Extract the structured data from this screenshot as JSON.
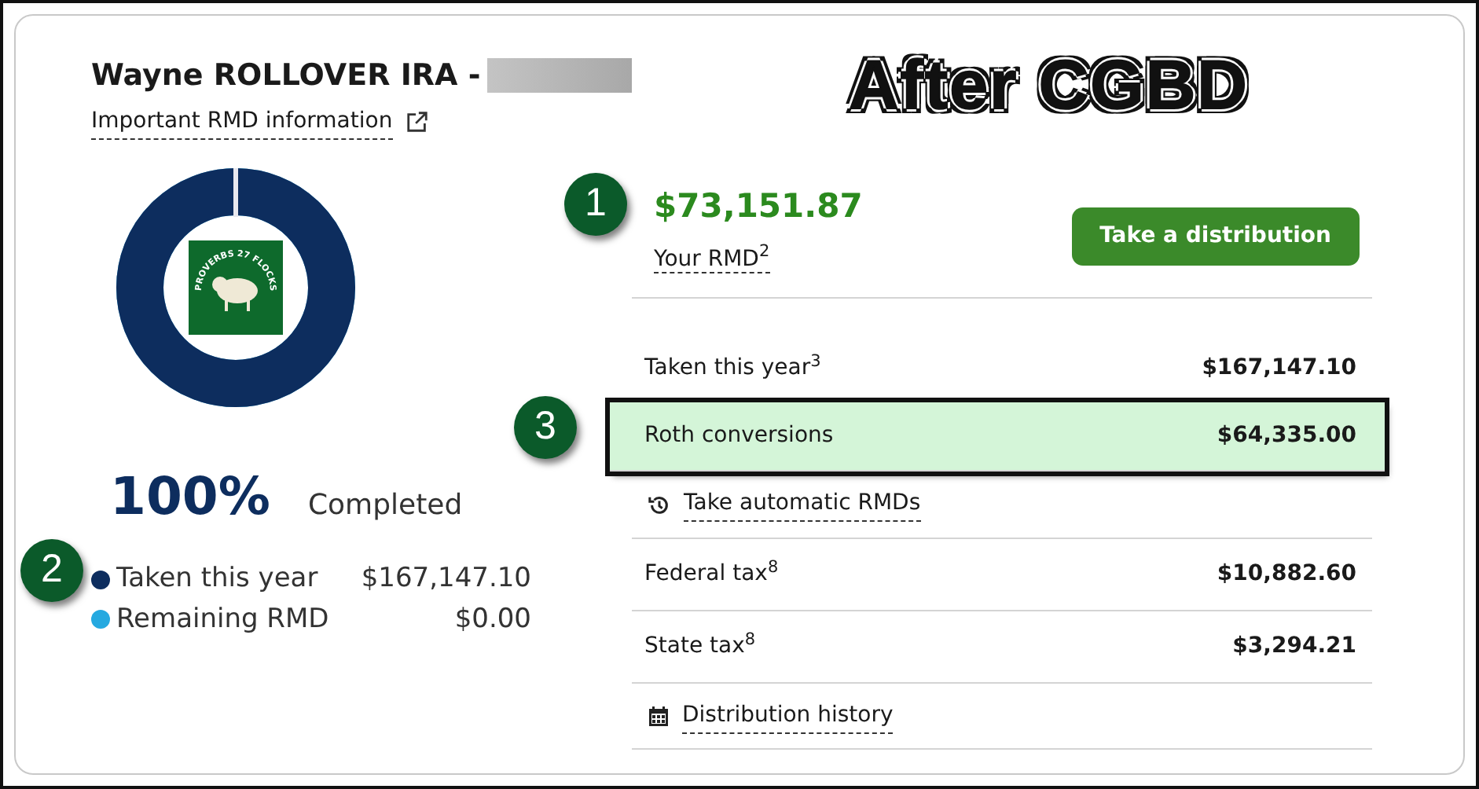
{
  "overlay_title": "After CGBD",
  "account": {
    "title": "Wayne ROLLOVER IRA -",
    "info_link": "Important RMD information"
  },
  "logo": {
    "text": "PROVERBS 27 FLOCKS"
  },
  "progress": {
    "level": 1,
    "percent": "100%",
    "label": "Completed"
  },
  "legend": [
    {
      "label": "Taken this year",
      "amount": "$167,147.10",
      "color": "#0d2d5e",
      "marker": "2"
    },
    {
      "label": "Remaining RMD",
      "amount": "$0.00",
      "color": "#25a9e0"
    }
  ],
  "rmd": {
    "amount": "$73,151.87",
    "label": "Your RMD$^{2}$",
    "marker": "1"
  },
  "button": "Take a distribution",
  "rows": [
    {
      "kind": "value",
      "label": "Taken this year$^{3}$",
      "amount": "$167,147.10",
      "highlighted": false
    },
    {
      "kind": "value",
      "label": "Roth conversions",
      "amount": "$64,335.00",
      "highlighted": true,
      "marker": "3"
    },
    {
      "kind": "automatic",
      "label": "Take automatic RMDs"
    },
    {
      "kind": "value",
      "label": "Federal tax$^{8}$",
      "amount": "$10,882.60",
      "highlighted": false
    },
    {
      "kind": "value",
      "label": "State tax$^{8}$",
      "amount": "$3,294.21",
      "highlighted": false
    },
    {
      "kind": "history",
      "label": "Distribution history"
    }
  ]
}
